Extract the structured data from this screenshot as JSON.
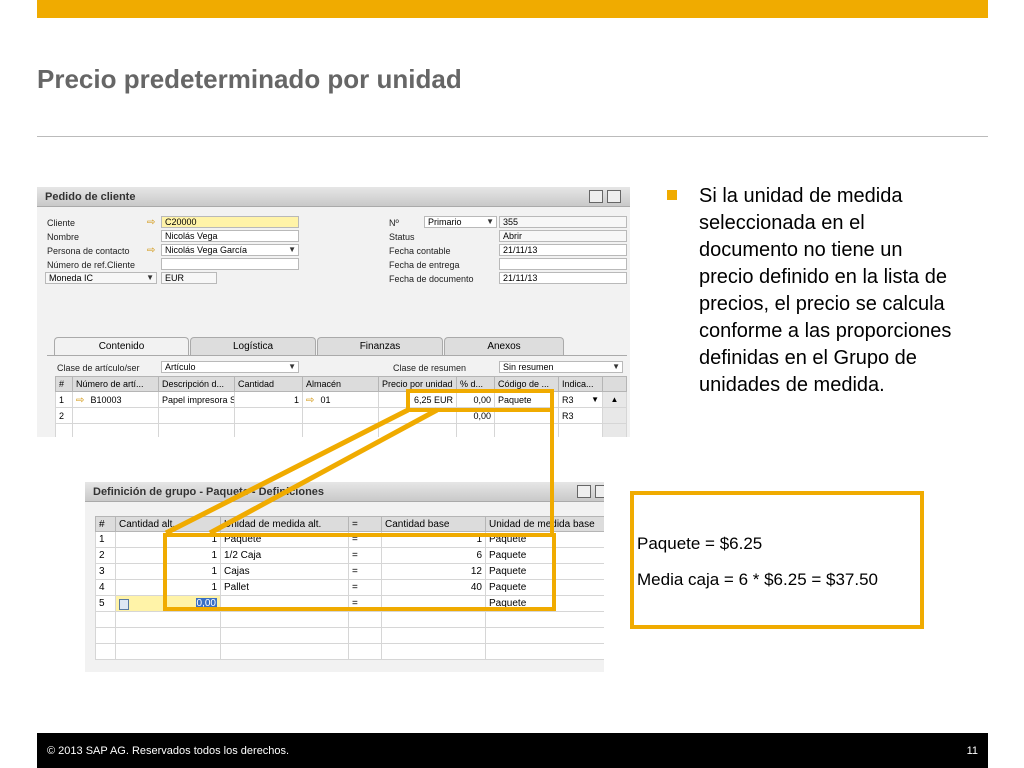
{
  "slide": {
    "title": "Precio predeterminado por unidad",
    "bullet": "Si la unidad de medida seleccionada en el documento no tiene un precio definido en la lista de precios, el precio se calcula conforme a las proporciones definidas en el Grupo de unidades de medida.",
    "calc_line1": "Paquete = $6.25",
    "calc_line2": "Media caja = 6 * $6.25 = $37.50",
    "footer_copyright": "© 2013 SAP AG. Reservados todos los derechos.",
    "page_number": "11",
    "accent_color": "#F0AB00"
  },
  "sales_order": {
    "window_title": "Pedido de cliente",
    "labels": {
      "cliente": "Cliente",
      "nombre": "Nombre",
      "persona": "Persona de contacto",
      "numref": "Número de ref.Cliente",
      "moneda": "Moneda IC",
      "no": "Nº",
      "status": "Status",
      "fecha_contable": "Fecha contable",
      "fecha_entrega": "Fecha de entrega",
      "fecha_doc": "Fecha de documento",
      "clase_articulo": "Clase de artículo/ser",
      "clase_resumen": "Clase de resumen"
    },
    "values": {
      "cliente": "C20000",
      "nombre": "Nicolás Vega",
      "persona": "Nicolás Vega García",
      "numref": "",
      "moneda_code": "EUR",
      "series": "Primario",
      "doc_num": "355",
      "status": "Abrir",
      "fecha_contable": "21/11/13",
      "fecha_entrega": "",
      "fecha_doc": "21/11/13",
      "clase_articulo": "Artículo",
      "clase_resumen": "Sin resumen"
    },
    "tabs": [
      "Contenido",
      "Logística",
      "Finanzas",
      "Anexos"
    ],
    "columns": [
      "#",
      "Número de artí...",
      "Descripción d...",
      "Cantidad",
      "Almacén",
      "Precio por unidad",
      "% d...",
      "Código de ...",
      "Indica..."
    ],
    "rows": [
      [
        "1",
        "B10003",
        "Papel impresora S",
        "1",
        "01",
        "6,25 EUR",
        "0,00",
        "Paquete",
        "R3"
      ],
      [
        "2",
        "",
        "",
        "",
        "",
        "",
        "0,00",
        "",
        "R3"
      ]
    ]
  },
  "uom_group": {
    "window_title": "Definición de grupo - Paquete - Definiciones",
    "columns": [
      "#",
      "Cantidad alt.",
      "Unidad de medida alt.",
      "=",
      "Cantidad base",
      "Unidad de medida base"
    ],
    "rows": [
      [
        "1",
        "1",
        "Paquete",
        "=",
        "1",
        "Paquete"
      ],
      [
        "2",
        "1",
        "1/2 Caja",
        "=",
        "6",
        "Paquete"
      ],
      [
        "3",
        "1",
        "Cajas",
        "=",
        "12",
        "Paquete"
      ],
      [
        "4",
        "1",
        "Pallet",
        "=",
        "40",
        "Paquete"
      ],
      [
        "5",
        "0,00",
        "",
        "=",
        "",
        "Paquete"
      ]
    ]
  }
}
